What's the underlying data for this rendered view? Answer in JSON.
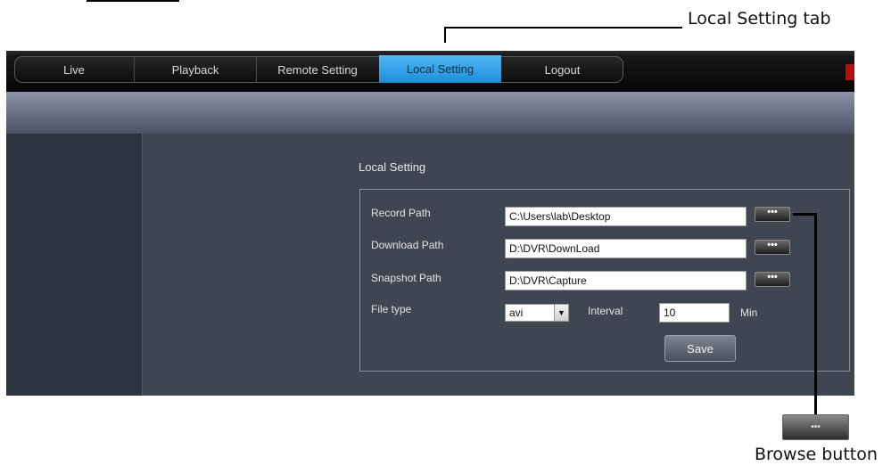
{
  "annotations": {
    "tab_callout": "Local Setting tab",
    "browse_callout": "Browse button"
  },
  "nav": {
    "tabs": [
      "Live",
      "Playback",
      "Remote Setting",
      "Local Setting",
      "Logout"
    ],
    "active_tab": "Local Setting"
  },
  "local_setting": {
    "title": "Local Setting",
    "record_path": {
      "label": "Record Path",
      "value": "C:\\Users\\lab\\Desktop"
    },
    "download_path": {
      "label": "Download Path",
      "value": "D:\\DVR\\DownLoad"
    },
    "snapshot_path": {
      "label": "Snapshot Path",
      "value": "D:\\DVR\\Capture"
    },
    "browse_glyph": "•••",
    "file_type": {
      "label": "File type",
      "value": "avi",
      "arrow": "▼"
    },
    "interval": {
      "label": "Interval",
      "value": "10",
      "unit": "Min"
    },
    "save_label": "Save"
  },
  "colors": {
    "active_tab": "#2b9fe6",
    "nav_bg": "#0e0e0e",
    "panel_bg": "#3f4651"
  }
}
